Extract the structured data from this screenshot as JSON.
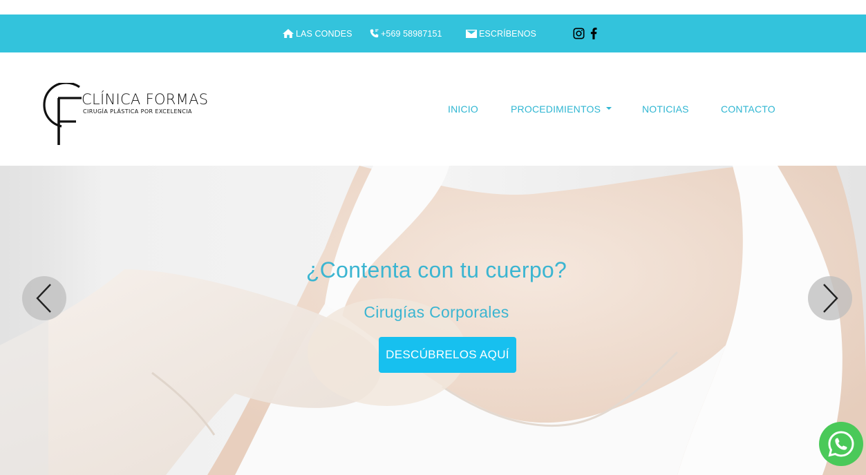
{
  "topbar": {
    "location": "LAS CONDES",
    "phone": "+569 58987151",
    "email_label": "ESCRÍBENOS"
  },
  "logo": {
    "name": "CLÍNICA FORMAS",
    "tagline": "CIRUGÍA PLÁSTICA POR EXCELENCIA"
  },
  "nav": {
    "items": [
      {
        "label": "INICIO"
      },
      {
        "label": "PROCEDIMIENTOS"
      },
      {
        "label": "NOTICIAS"
      },
      {
        "label": "CONTACTO"
      }
    ]
  },
  "hero": {
    "title": "¿Contenta con tu cuerpo?",
    "subtitle": "Cirugías Corporales",
    "button_label": "DESCÚBRELOS AQUÍ"
  },
  "colors": {
    "brand_cyan": "#33c3dc",
    "link_cyan": "#2fb6d2",
    "button_blue": "#17c0ef",
    "whatsapp_green": "#4ac959"
  },
  "icons": [
    "home-icon",
    "phone-icon",
    "mail-icon",
    "instagram-icon",
    "facebook-icon",
    "chevron-left-icon",
    "chevron-right-icon",
    "whatsapp-icon"
  ]
}
